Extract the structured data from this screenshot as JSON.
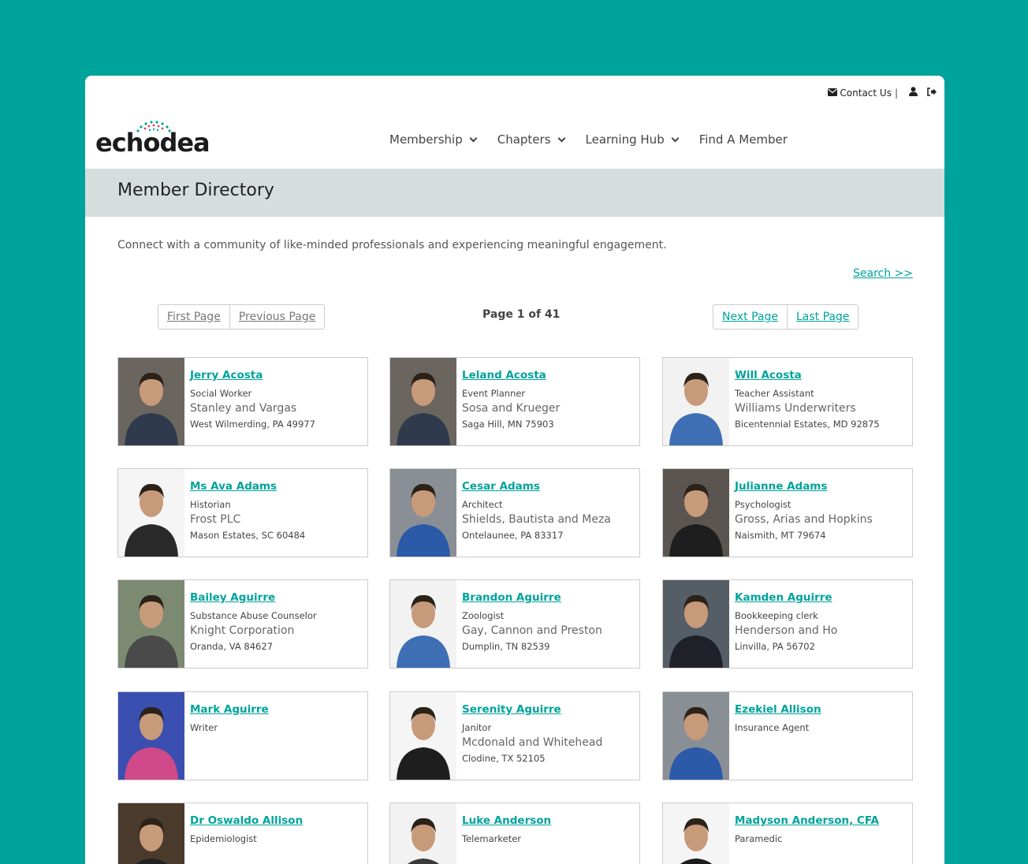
{
  "topbar": {
    "contact_label": "Contact Us"
  },
  "logo": {
    "text": "echodea"
  },
  "nav": {
    "items": [
      {
        "label": "Membership"
      },
      {
        "label": "Chapters"
      },
      {
        "label": "Learning Hub"
      },
      {
        "label": "Find A Member"
      }
    ]
  },
  "page": {
    "title": "Member Directory",
    "intro": "Connect with a community of like-minded professionals and experiencing meaningful engagement.",
    "search_link": "Search >>"
  },
  "pagination": {
    "first": "First Page",
    "previous": "Previous Page",
    "info": "Page 1 of 41",
    "next": "Next Page",
    "last": "Last Page"
  },
  "members": [
    {
      "name": "Jerry Acosta",
      "job": "Social Worker",
      "org": "Stanley and Vargas",
      "location": "West Wilmerding, PA 49977",
      "photo_bg": "#6b6560",
      "photo_fg": "#2f3b4d"
    },
    {
      "name": "Leland Acosta",
      "job": "Event Planner",
      "org": "Sosa and Krueger",
      "location": "Saga Hill, MN 75903",
      "photo_bg": "#6b6560",
      "photo_fg": "#2f3b4d"
    },
    {
      "name": "Will Acosta",
      "job": "Teacher Assistant",
      "org": "Williams Underwriters",
      "location": "Bicentennial Estates, MD 92875",
      "photo_bg": "#f2f2f2",
      "photo_fg": "#3e6fb5"
    },
    {
      "name": "Ms Ava Adams",
      "job": "Historian",
      "org": "Frost PLC",
      "location": "Mason Estates, SC 60484",
      "photo_bg": "#f5f5f5",
      "photo_fg": "#2a2a2a"
    },
    {
      "name": "Cesar Adams",
      "job": "Architect",
      "org": "Shields, Bautista and Meza",
      "location": "Ontelaunee, PA 83317",
      "photo_bg": "#8a8f96",
      "photo_fg": "#2a5aa8"
    },
    {
      "name": "Julianne Adams",
      "job": "Psychologist",
      "org": "Gross, Arias and Hopkins",
      "location": "Naismith, MT 79674",
      "photo_bg": "#5a5550",
      "photo_fg": "#1e1e1e"
    },
    {
      "name": "Bailey Aguirre",
      "job": "Substance Abuse Counselor",
      "org": "Knight Corporation",
      "location": "Oranda, VA 84627",
      "photo_bg": "#7d8a72",
      "photo_fg": "#4a4a4a"
    },
    {
      "name": "Brandon Aguirre",
      "job": "Zoologist",
      "org": "Gay, Cannon and Preston",
      "location": "Dumplin, TN 82539",
      "photo_bg": "#f2f2f2",
      "photo_fg": "#3e6fb5"
    },
    {
      "name": "Kamden Aguirre",
      "job": "Bookkeeping clerk",
      "org": "Henderson and Ho",
      "location": "Linvilla, PA 56702",
      "photo_bg": "#555d66",
      "photo_fg": "#1e2228"
    },
    {
      "name": "Mark Aguirre",
      "job": "Writer",
      "org": "",
      "location": "",
      "photo_bg": "#3a4fb0",
      "photo_fg": "#d04a8a"
    },
    {
      "name": "Serenity Aguirre",
      "job": "Janitor",
      "org": "Mcdonald and Whitehead",
      "location": "Clodine, TX 52105",
      "photo_bg": "#f5f5f5",
      "photo_fg": "#1e1e1e"
    },
    {
      "name": "Ezekiel Allison",
      "job": "Insurance Agent",
      "org": "",
      "location": "",
      "photo_bg": "#8a8f96",
      "photo_fg": "#2a5aa8"
    },
    {
      "name": "Dr Oswaldo Allison",
      "job": "Epidemiologist",
      "org": "",
      "location": "",
      "photo_bg": "#4a3a2c",
      "photo_fg": "#222"
    },
    {
      "name": "Luke Anderson",
      "job": "Telemarketer",
      "org": "",
      "location": "",
      "photo_bg": "#f2f2f2",
      "photo_fg": "#3a3a3a"
    },
    {
      "name": "Madyson Anderson, CFA",
      "job": "Paramedic",
      "org": "",
      "location": "",
      "photo_bg": "#f5f5f5",
      "photo_fg": "#1e1e1e"
    }
  ]
}
